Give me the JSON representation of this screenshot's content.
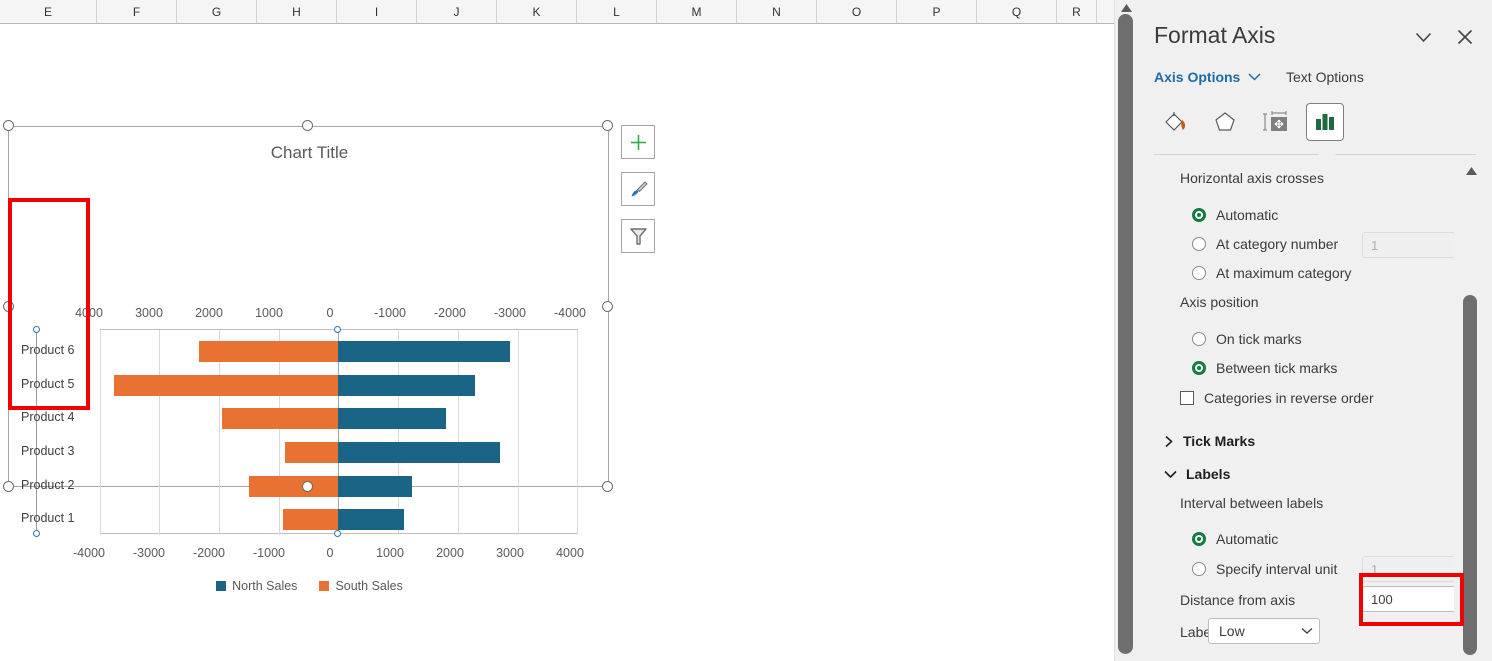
{
  "spreadsheet": {
    "columns": [
      "E",
      "F",
      "G",
      "H",
      "I",
      "J",
      "K",
      "L",
      "M",
      "N",
      "O",
      "P",
      "Q",
      "R"
    ]
  },
  "chart": {
    "title": "Chart Title",
    "elements_button": "chart-elements",
    "styles_button": "chart-styles",
    "filters_button": "chart-filters",
    "colors": {
      "north": "#1a6585",
      "south": "#e97132"
    }
  },
  "chart_data": {
    "type": "bar",
    "title": "Chart Title",
    "orientation": "horizontal",
    "categories": [
      "Product 1",
      "Product 2",
      "Product 3",
      "Product 4",
      "Product 5",
      "Product 6"
    ],
    "series": [
      {
        "name": "North Sales",
        "color": "#1a6585",
        "values": [
          1100,
          1230,
          2700,
          1800,
          2270,
          2850
        ]
      },
      {
        "name": "South Sales",
        "color": "#e97132",
        "values": [
          -920,
          -1480,
          -880,
          -1930,
          -3730,
          -2320
        ]
      }
    ],
    "top_axis_ticks": [
      "4000",
      "3000",
      "2000",
      "1000",
      "0",
      "-1000",
      "-2000",
      "-3000",
      "-4000"
    ],
    "bottom_axis_ticks": [
      "-4000",
      "-3000",
      "-2000",
      "-1000",
      "0",
      "1000",
      "2000",
      "3000",
      "4000"
    ],
    "xlabel": "",
    "ylabel": "",
    "xlim": [
      -4500,
      4500
    ],
    "grid": true,
    "legend_position": "bottom",
    "legend": [
      "North Sales",
      "South Sales"
    ]
  },
  "pane": {
    "title": "Format Axis",
    "collapse_icon": "chevron-down-icon",
    "close_icon": "close-icon",
    "tabs": {
      "axis_options": "Axis Options",
      "text_options": "Text Options"
    },
    "icon_tabs": [
      {
        "name": "fill-and-line-icon"
      },
      {
        "name": "effects-icon"
      },
      {
        "name": "size-and-properties-icon"
      },
      {
        "name": "axis-options-chart-icon"
      }
    ],
    "sections": {
      "horizontal_axis_crosses": {
        "heading": "Horizontal axis crosses",
        "options": [
          {
            "label": "Automatic",
            "selected": true
          },
          {
            "label": "At category number",
            "selected": false,
            "value": "1"
          },
          {
            "label": "At maximum category",
            "selected": false
          }
        ]
      },
      "axis_position": {
        "heading": "Axis position",
        "options": [
          {
            "label": "On tick marks",
            "selected": false
          },
          {
            "label": "Between tick marks",
            "selected": true
          }
        ],
        "checkbox": {
          "label": "Categories in reverse order",
          "checked": false
        }
      },
      "tick_marks": {
        "heading": "Tick Marks",
        "expanded": false,
        "chevron": "chevron-right-icon"
      },
      "labels": {
        "heading": "Labels",
        "expanded": true,
        "chevron": "chevron-down-icon",
        "interval_heading": "Interval between labels",
        "options": [
          {
            "label": "Automatic",
            "selected": true
          },
          {
            "label": "Specify interval unit",
            "selected": false,
            "value": "1"
          }
        ],
        "distance_from_axis": {
          "label": "Distance from axis",
          "value": "100"
        },
        "label_position": {
          "label": "Label Position",
          "value": "Low"
        }
      }
    }
  },
  "annotations": {
    "highlight_color": "#f20000",
    "boxes": [
      "category-axis-labels",
      "distance-from-axis-field"
    ]
  }
}
